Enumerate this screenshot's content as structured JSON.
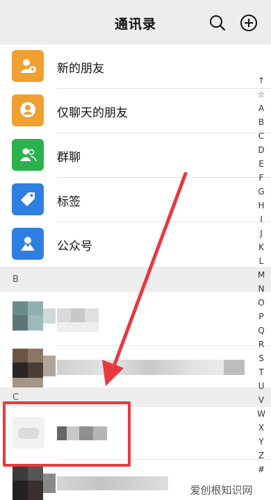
{
  "header": {
    "title": "通讯录"
  },
  "features": [
    {
      "label": "新的朋友",
      "color": "#f0a030",
      "icon": "new-friend-icon"
    },
    {
      "label": "仅聊天的朋友",
      "color": "#f0a030",
      "icon": "chat-only-friend-icon"
    },
    {
      "label": "群聊",
      "color": "#2bb24c",
      "icon": "group-chat-icon"
    },
    {
      "label": "标签",
      "color": "#2e7fe0",
      "icon": "tag-icon"
    },
    {
      "label": "公众号",
      "color": "#2e7fe0",
      "icon": "official-account-icon"
    }
  ],
  "sections": [
    {
      "letter": "B"
    },
    {
      "letter": "C"
    }
  ],
  "index_letters": [
    "↑",
    "☆",
    "A",
    "B",
    "C",
    "D",
    "E",
    "F",
    "G",
    "H",
    "I",
    "J",
    "K",
    "L",
    "M",
    "N",
    "O",
    "P",
    "Q",
    "R",
    "S",
    "T",
    "U",
    "V",
    "W",
    "X",
    "Y",
    "Z",
    "#"
  ],
  "watermark": "爱创根知识网",
  "colors": {
    "annotation_red": "#e8393f",
    "background": "#ededed"
  }
}
